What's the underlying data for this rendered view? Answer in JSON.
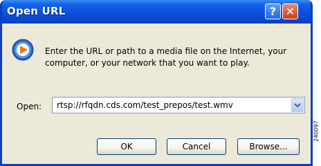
{
  "window": {
    "title": "Open URL"
  },
  "title_buttons": {
    "help_label": "?",
    "close_label": "✕"
  },
  "dialog": {
    "message": "Enter the URL or path to a media file on the Internet, your computer, or your network that you want to play.",
    "open_label": "Open:",
    "url_value": "rtsp://rfqdn.cds.com/test_prepos/test.wmv"
  },
  "buttons": {
    "ok": "OK",
    "cancel": "Cancel",
    "browse": "Browse..."
  },
  "figure_code": "240097",
  "colors": {
    "titlebar": "#0a4fdc",
    "dialog_bg": "#ece9d8",
    "close_button": "#c44020",
    "field_border": "#7f9db9"
  },
  "icons": {
    "app_icon": "windows-media-player-icon",
    "dropdown_icon": "chevron-down-icon"
  }
}
